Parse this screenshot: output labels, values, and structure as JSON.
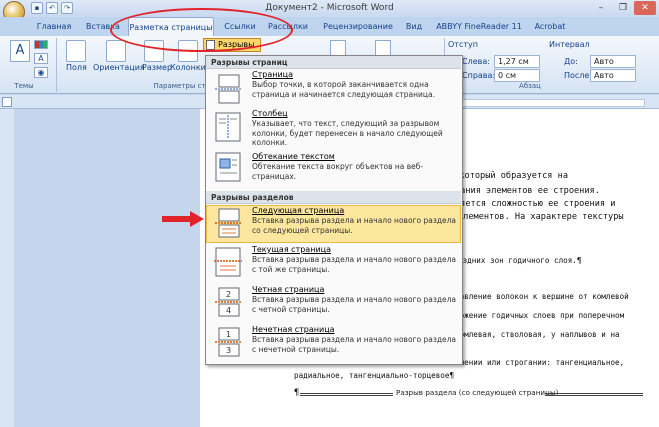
{
  "window": {
    "title": "Документ2 - Microsoft Word",
    "controls": [
      "–",
      "❐",
      "✕"
    ]
  },
  "tabs": [
    "Главная",
    "Вставка",
    "Разметка страницы",
    "Ссылки",
    "Рассылки",
    "Рецензирование",
    "Вид",
    "ABBYY FineReader 11",
    "Acrobat"
  ],
  "ribbon": {
    "themes_label": "Темы",
    "buttons": {
      "fields": "Поля",
      "orientation": "Ориентация",
      "size": "Размер",
      "columns": "Колонки"
    },
    "breaks_label": "Разрывы",
    "group_page_setup": "Параметры стр",
    "indent": {
      "header": "Отступ",
      "left_label": "Слева:",
      "left_value": "1,27 см",
      "right_label": "Справа:",
      "right_value": "0 см"
    },
    "spacing": {
      "header": "Интервал",
      "before_label": "До:",
      "before_value": "Авто",
      "after_label": "После:",
      "after_value": "Авто"
    },
    "group_paragraph": "Абзац"
  },
  "menu": {
    "header_page_breaks": "Разрывы страниц",
    "header_section_breaks": "Разрывы разделов",
    "items": [
      {
        "title": "Страница",
        "desc": "Выбор точки, в которой заканчивается одна страница и начинается следующая страница."
      },
      {
        "title": "Столбец",
        "desc": "Указывает, что текст, следующий за разрывом колонки, будет перенесен в начало следующей колонки."
      },
      {
        "title": "Обтекание текстом",
        "desc": "Обтекание текста вокруг объектов на веб-страницах."
      },
      {
        "title": "Следующая страница",
        "desc": "Вставка разрыва раздела и начало нового раздела со следующей страницы."
      },
      {
        "title": "Текущая страница",
        "desc": "Вставка разрыва раздела и начало нового раздела с той же страницы."
      },
      {
        "title": "Четная страница",
        "desc": "Вставка разрыва раздела и начало нового раздела с четной страницы."
      },
      {
        "title": "Нечетная страница",
        "desc": "Вставка разрыва раздела и начало нового раздела с нечетной страницы."
      }
    ]
  },
  "document": {
    "lines": [
      ", который образуется на",
      "вания элементов ее строения.",
      "ляется сложностью ее строения и",
      "элементов. На характере текстуры",
      "оздних зон годичного слоя.¶",
      "равление волокон к вершине от комлевой",
      "ложение годичных слоев при поперечном",
      "комлевая, стволовая, у наплывов и на",
      "ешении или строгании: тангенциальное,",
      "радиальное, тангенциально-торцевое¶"
    ],
    "section_break": "Разрыв раздела (со следующей страницы)",
    "pilcrow": "¶"
  },
  "colors": {
    "highlight": "#fde79f",
    "annotation": "#e2232a"
  }
}
